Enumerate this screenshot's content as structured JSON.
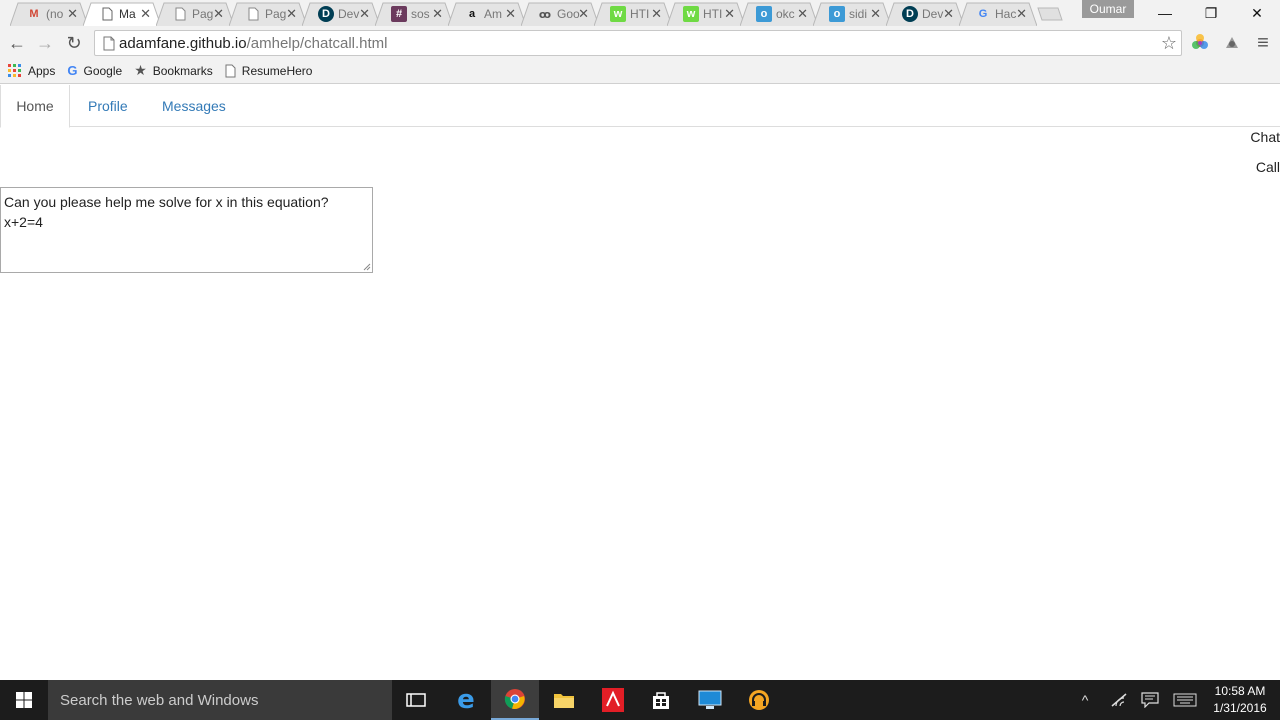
{
  "browser": {
    "tabs": [
      {
        "title": "(no",
        "icon": "gmail-icon",
        "color": "#d14836",
        "glyph": "M"
      },
      {
        "title": "Ma",
        "icon": "page-icon",
        "color": "#666666",
        "glyph": "",
        "active": true
      },
      {
        "title": "Pag",
        "icon": "page-icon",
        "color": "#888888",
        "glyph": ""
      },
      {
        "title": "Pag",
        "icon": "page-icon",
        "color": "#888888",
        "glyph": ""
      },
      {
        "title": "Dev",
        "icon": "devpost-icon",
        "color": "#003e54",
        "glyph": "D"
      },
      {
        "title": "sos",
        "icon": "slack-icon",
        "color": "#4a4a4a",
        "glyph": "#"
      },
      {
        "title": "Am",
        "icon": "amazon-icon",
        "color": "#111111",
        "glyph": "a"
      },
      {
        "title": "Goo",
        "icon": "goo-icon",
        "color": "#555555",
        "glyph": "ꝏ"
      },
      {
        "title": "HTI",
        "icon": "upwork-icon",
        "color": "#6fda44",
        "glyph": "w"
      },
      {
        "title": "HTI",
        "icon": "upwork-icon",
        "color": "#6fda44",
        "glyph": "w"
      },
      {
        "title": "okc",
        "icon": "okcupid-icon",
        "color": "#3c9ad6",
        "glyph": "o"
      },
      {
        "title": "sidi",
        "icon": "okcupid-icon",
        "color": "#3c9ad6",
        "glyph": "o"
      },
      {
        "title": "Dev",
        "icon": "devpost-icon",
        "color": "#003e54",
        "glyph": "D"
      },
      {
        "title": "Hac",
        "icon": "google-icon",
        "color": "#4285f4",
        "glyph": "G"
      }
    ],
    "tab_close_glyph": "✕",
    "profile_name": "Oumar",
    "window_controls": {
      "minimize": "—",
      "maximize": "❐",
      "close": "✕"
    },
    "url_host": "adamfane.github.io",
    "url_path": "/amhelp/chatcall.html",
    "nav_glyphs": {
      "back": "←",
      "forward": "→",
      "reload": "↻",
      "star": "☆",
      "menu": "≡"
    },
    "bookmarks": [
      {
        "label": "Apps",
        "icon": "apps-grid-icon"
      },
      {
        "label": "Google",
        "icon": "google-icon"
      },
      {
        "label": "Bookmarks",
        "icon": "star-icon"
      },
      {
        "label": "ResumeHero",
        "icon": "page-icon"
      }
    ]
  },
  "page": {
    "nav_tabs": [
      {
        "label": "Home",
        "active": true
      },
      {
        "label": "Profile",
        "active": false
      },
      {
        "label": "Messages",
        "active": false
      }
    ],
    "chat_label": "Chat",
    "call_label": "Call",
    "message_text": "Can you please help me solve for x in this equation?\nx+2=4"
  },
  "taskbar": {
    "search_placeholder": "Search the web and Windows",
    "apps": [
      "task-view-icon",
      "edge-icon",
      "chrome-icon",
      "file-explorer-icon",
      "adobe-reader-icon",
      "store-icon",
      "lenovo-icon",
      "headphones-icon"
    ],
    "time": "10:58 AM",
    "date": "1/31/2016"
  },
  "colors": {
    "link": "#337ab7",
    "taskbar_bg": "#1c1c1c",
    "chrome_bg": "#f2f2f2"
  }
}
